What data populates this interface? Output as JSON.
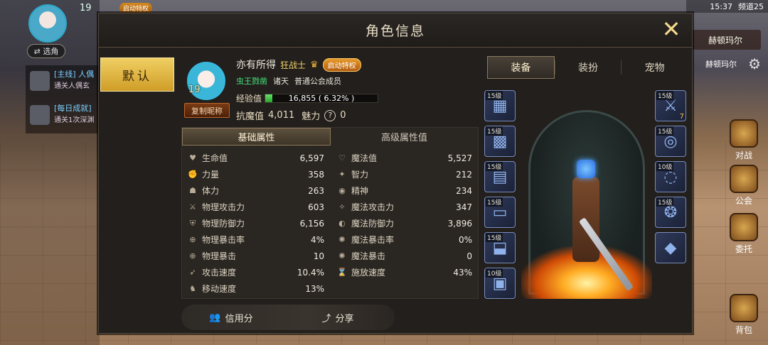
{
  "hud": {
    "level": "19",
    "vip_badge": "启动特权",
    "select_label": "⇄ 选角",
    "quests": [
      {
        "title": "[主线] 人偶",
        "desc": "通关人偶玄"
      },
      {
        "title": "[每日成就]",
        "desc": "通关1次深渊"
      }
    ],
    "status_time": "15:37",
    "status_channel": "频道25",
    "town_label": "赫顿玛尔",
    "town_sub": "赫顿玛尔",
    "side_buttons": [
      "对战",
      "公会",
      "委托",
      "背包"
    ]
  },
  "panel": {
    "title": "角色信息",
    "default_tab": "默认",
    "copy_nickname": "复制昵称",
    "avatar_level": "19",
    "name": "亦有所得",
    "class_name": "狂战士",
    "vip_label": "启动特权",
    "tags": [
      "虫王戮凿",
      "诸天",
      "普通公会成员"
    ],
    "exp_label": "经验值",
    "exp_value": "16,855 ( 6.32% )",
    "exp_fraction": 0.0632,
    "mag_label": "抗魔值",
    "mag_value": "4,011",
    "charm_label": "魅力",
    "charm_value": "0",
    "stat_tabs": [
      "基础属性",
      "高级属性值"
    ],
    "stats": [
      [
        {
          "icon": "heart-icon",
          "label": "生命值",
          "value": "6,597"
        },
        {
          "icon": "mana-heart-icon",
          "label": "魔法值",
          "value": "5,527"
        }
      ],
      [
        {
          "icon": "fist-icon",
          "label": "力量",
          "value": "358"
        },
        {
          "icon": "brain-icon",
          "label": "智力",
          "value": "212"
        }
      ],
      [
        {
          "icon": "body-icon",
          "label": "体力",
          "value": "263"
        },
        {
          "icon": "spirit-icon",
          "label": "精神",
          "value": "234"
        }
      ],
      [
        {
          "icon": "sword-icon",
          "label": "物理攻击力",
          "value": "603"
        },
        {
          "icon": "magic-attack-icon",
          "label": "魔法攻击力",
          "value": "347"
        }
      ],
      [
        {
          "icon": "shield-icon",
          "label": "物理防御力",
          "value": "6,156"
        },
        {
          "icon": "magic-shield-icon",
          "label": "魔法防御力",
          "value": "3,896"
        }
      ],
      [
        {
          "icon": "crosshair-icon",
          "label": "物理暴击率",
          "value": "4%"
        },
        {
          "icon": "magic-crit-icon",
          "label": "魔法暴击率",
          "value": "0%"
        }
      ],
      [
        {
          "icon": "crosshair-icon",
          "label": "物理暴击",
          "value": "10"
        },
        {
          "icon": "magic-crit-icon",
          "label": "魔法暴击",
          "value": "0"
        }
      ],
      [
        {
          "icon": "attack-speed-icon",
          "label": "攻击速度",
          "value": "10.4%"
        },
        {
          "icon": "cast-speed-icon",
          "label": "施放速度",
          "value": "43%"
        }
      ],
      [
        {
          "icon": "boot-icon",
          "label": "移动速度",
          "value": "13%"
        },
        null
      ]
    ],
    "credit_label": "信用分",
    "share_label": "分享",
    "right_tabs": [
      "装备",
      "装扮",
      "宠物"
    ],
    "left_slots": [
      {
        "level": "15级",
        "name": "shoulder-armor-icon"
      },
      {
        "level": "15级",
        "name": "chest-armor-icon"
      },
      {
        "level": "15级",
        "name": "leg-armor-icon"
      },
      {
        "level": "15级",
        "name": "belt-icon"
      },
      {
        "level": "15级",
        "name": "boots-icon"
      },
      {
        "level": "10级",
        "name": "title-icon"
      }
    ],
    "right_slots": [
      {
        "level": "15级",
        "name": "weapon-icon",
        "enhance": "7"
      },
      {
        "level": "15级",
        "name": "bracelet-icon",
        "enhance": ""
      },
      {
        "level": "10级",
        "name": "ring-icon",
        "enhance": ""
      },
      {
        "level": "15级",
        "name": "necklace-icon",
        "enhance": ""
      },
      {
        "level": "",
        "name": "special-item-icon",
        "enhance": ""
      }
    ]
  }
}
